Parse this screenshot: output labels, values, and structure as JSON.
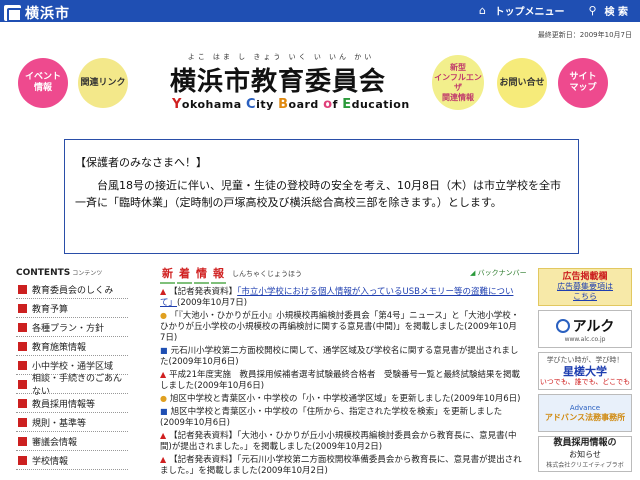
{
  "topbar": {
    "site_name": "横浜市",
    "top_menu_label": "トップメニュー",
    "search_label": "検 索"
  },
  "updated": "最終更新日：2009年10月7日",
  "header": {
    "ruby": "よこ はま し きょう いく い いん かい",
    "title": "横浜市教育委員会",
    "subtitle": {
      "Y": "Y",
      "okohama": "okohama ",
      "C": "C",
      "ity": "ity ",
      "B": "B",
      "oard": "oard ",
      "o": "o",
      "f": "f ",
      "E": "E",
      "ducation": "ducation"
    },
    "bubbles": {
      "event": "イベント\n情報",
      "links": "関連リンク",
      "flu": "新型\nインフルエンザ\n関連情報",
      "contact": "お問い合せ",
      "sitemap": "サイト\nマップ"
    }
  },
  "notice": {
    "heading": "【保護者のみなさまへ！】",
    "body": "台風18号の接近に伴い、児童・生徒の登校時の安全を考え、10月8日（木）は市立学校を全市一斉に「臨時休業」（定時制の戸塚高校及び横浜総合高校三部を除きます。）とします。"
  },
  "contents": {
    "heading": "CONTENTS",
    "heading_small": "コンテンツ",
    "items": [
      "教育委員会のしくみ",
      "教育予算",
      "各種プラン・方針",
      "教育施策情報",
      "小中学校・通学区域",
      "相談・手続きのごあんない",
      "教員採用情報等",
      "規則・基準等",
      "審議会情報",
      "学校情報"
    ]
  },
  "news": {
    "heading_chars": [
      "新",
      "着",
      "情",
      "報"
    ],
    "heading_ruby": "しんちゃくじょうほう",
    "back_number": "バックナンバー",
    "items": [
      {
        "mark": "tri",
        "text": "【記者発表資料】",
        "link": "「市立小学校における個人情報が入っているUSBメモリー等の盗難について」",
        "date": "(2009年10月7日)"
      },
      {
        "mark": "dot",
        "text": "「『大池小・ひかりが丘小』小規模校再編検討委員会「第4号」ニュース」と「大池小学校・ひかりが丘小学校の小規模校の再編検討に関する意見書(中間)」を掲載しました",
        "link": "",
        "date": "(2009年10月7日)"
      },
      {
        "mark": "sq",
        "text": "元石川小学校第二方面校開校に関して、通学区域及び学校名に関する意見書が提出されました",
        "link": "",
        "date": "(2009年10月6日)"
      },
      {
        "mark": "tri",
        "text": "平成21年度実施　教員採用候補者選考試験最終合格者　受験番号一覧と最終試験結果を掲載しました",
        "link": "",
        "date": "(2009年10月6日)"
      },
      {
        "mark": "dot",
        "text": "旭区中学校と青葉区小・中学校の「小・中学校通学区域」を更新しました",
        "link": "",
        "date": "(2009年10月6日)"
      },
      {
        "mark": "sq",
        "text": "旭区中学校と青葉区小・中学校の「住所から、指定された学校を検索」を更新しました",
        "link": "",
        "date": "(2009年10月6日)"
      },
      {
        "mark": "tri",
        "text": "【記者発表資料】「大池小・ひかりが丘小小規模校再編検討委員会から教育長に、意見書(中間)が提出されました。」を掲載しました",
        "link": "",
        "date": "(2009年10月2日)"
      },
      {
        "mark": "tri",
        "text": "【記者発表資料】「元石川小学校第二方面校開校準備委員会から教育長に、意見書が提出されました。」を掲載しました",
        "link": "",
        "date": "(2009年10月2日)"
      }
    ]
  },
  "ads": {
    "head_title": "広告掲載欄",
    "head_link": "広告募集要項は\nこちら",
    "alc_name": "アルク",
    "alc_url": "www.alc.co.jp",
    "star_tag": "学びたい時が、学び時！",
    "star_name": "星槎大学",
    "star_sub": "いつでも、誰でも、どこでも",
    "adv_name": "Advance",
    "adv_sub": "アドバンス法務事務所",
    "info_title": "教員採用情報の",
    "info_sub": "お知らせ",
    "info_company": "株式会社クリエイティブラボ"
  }
}
